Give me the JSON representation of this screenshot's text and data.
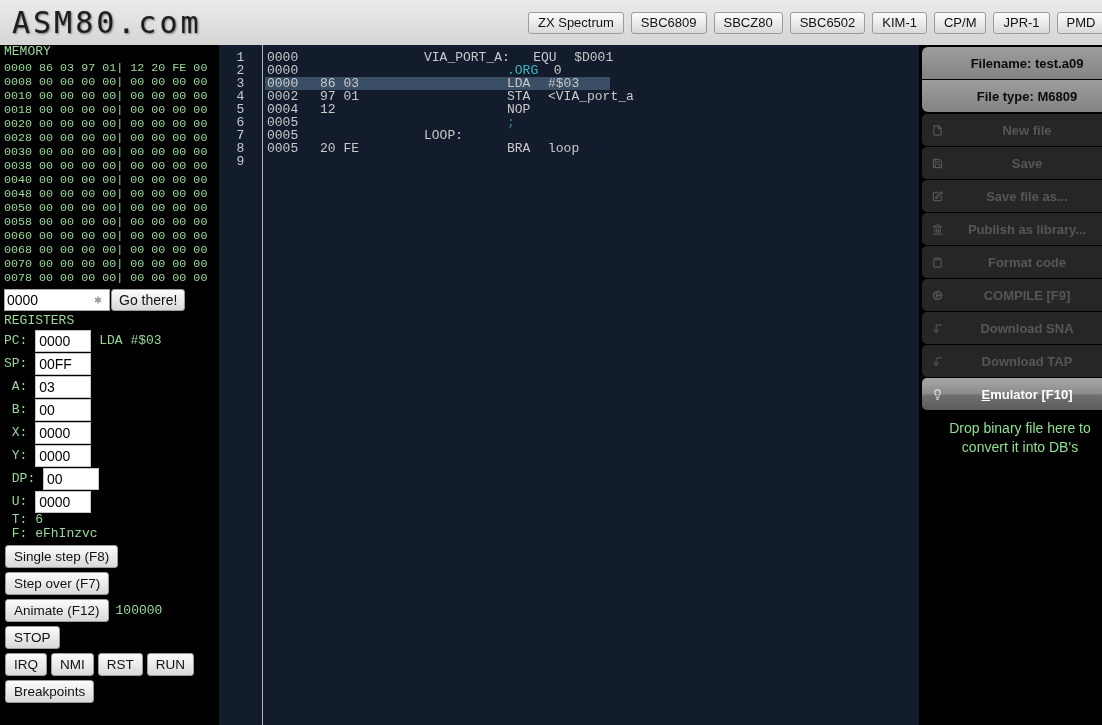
{
  "header": {
    "logo": "ASM80.com",
    "machines": [
      "ZX Spectrum",
      "SBC6809",
      "SBCZ80",
      "SBC6502",
      "KIM-1",
      "CP/M",
      "JPR-1",
      "PMD"
    ]
  },
  "memory": {
    "title": "MEMORY",
    "rows": [
      "0000 86 03 97 01| 12 20 FE 00",
      "0008 00 00 00 00| 00 00 00 00",
      "0010 00 00 00 00| 00 00 00 00",
      "0018 00 00 00 00| 00 00 00 00",
      "0020 00 00 00 00| 00 00 00 00",
      "0028 00 00 00 00| 00 00 00 00",
      "0030 00 00 00 00| 00 00 00 00",
      "0038 00 00 00 00| 00 00 00 00",
      "0040 00 00 00 00| 00 00 00 00",
      "0048 00 00 00 00| 00 00 00 00",
      "0050 00 00 00 00| 00 00 00 00",
      "0058 00 00 00 00| 00 00 00 00",
      "0060 00 00 00 00| 00 00 00 00",
      "0068 00 00 00 00| 00 00 00 00",
      "0070 00 00 00 00| 00 00 00 00",
      "0078 00 00 00 00| 00 00 00 00"
    ],
    "goto": {
      "value": "0000",
      "button": "Go there!"
    }
  },
  "registers": {
    "title": "REGISTERS",
    "fields": [
      {
        "label": "PC:",
        "value": "0000",
        "indented": false,
        "disassembly": "LDA #$03"
      },
      {
        "label": "SP:",
        "value": "00FF",
        "indented": false
      },
      {
        "label": "A:",
        "value": "03",
        "indented": true
      },
      {
        "label": "B:",
        "value": "00",
        "indented": true
      },
      {
        "label": "X:",
        "value": "0000",
        "indented": true
      },
      {
        "label": "Y:",
        "value": "0000",
        "indented": true
      },
      {
        "label": "DP:",
        "value": "00",
        "indented": true
      },
      {
        "label": "U:",
        "value": "0000",
        "indented": true
      }
    ],
    "readouts": [
      {
        "label": "T:",
        "value": "6"
      },
      {
        "label": "F:",
        "value": "eFhInzvc"
      }
    ]
  },
  "controls": [
    {
      "buttons": [
        "Single step (F8)"
      ]
    },
    {
      "buttons": [
        "Step over (F7)"
      ]
    },
    {
      "buttons": [
        "Animate (F12)"
      ],
      "note": "100000"
    },
    {
      "buttons": [
        "STOP"
      ]
    },
    {
      "buttons": [
        "IRQ",
        "NMI",
        "RST",
        "RUN"
      ]
    },
    {
      "buttons": [
        "Breakpoints"
      ]
    }
  ],
  "code": {
    "lines": [
      {
        "number": "1",
        "address": "0000",
        "label": "VIA_PORT_A:",
        "opcode": "EQU",
        "operand": "$D001",
        "kind": "equate",
        "current": false
      },
      {
        "number": "2",
        "address": "0000",
        "opcode": ".ORG",
        "operand": "0",
        "kind": "directive",
        "current": false
      },
      {
        "number": "3",
        "address": "0000",
        "bytes": "86 03",
        "opcode": "LDA",
        "operand": "#$03",
        "kind": "instruction",
        "current": true
      },
      {
        "number": "4",
        "address": "0002",
        "bytes": "97 01",
        "opcode": "STA",
        "operand": "<VIA_port_a",
        "kind": "instruction",
        "current": false
      },
      {
        "number": "5",
        "address": "0004",
        "bytes": "12",
        "opcode": "NOP",
        "kind": "instruction",
        "current": false
      },
      {
        "number": "6",
        "address": "0005",
        "comment": ";",
        "kind": "comment",
        "current": false
      },
      {
        "number": "7",
        "address": "0005",
        "label": "LOOP:",
        "kind": "label",
        "current": false
      },
      {
        "number": "8",
        "address": "0005",
        "bytes": "20 FE",
        "opcode": "BRA",
        "operand": "loop",
        "kind": "instruction",
        "current": false
      },
      {
        "number": "9",
        "kind": "blank",
        "current": false
      }
    ]
  },
  "side_menu": {
    "items": [
      {
        "kind": "info",
        "label": "Filename: test.a09"
      },
      {
        "kind": "info",
        "label": "File type: M6809"
      },
      {
        "kind": "action",
        "label": "New file",
        "disabled": true,
        "selected": false,
        "access_key": false
      },
      {
        "kind": "action",
        "label": "Save",
        "disabled": true,
        "selected": false,
        "access_key": false
      },
      {
        "kind": "action",
        "label": "Save file as...",
        "disabled": true,
        "selected": false,
        "access_key": false
      },
      {
        "kind": "action",
        "label": "Publish as library...",
        "disabled": true,
        "selected": false,
        "access_key": false
      },
      {
        "kind": "action",
        "label": "Format code",
        "disabled": true,
        "selected": false,
        "access_key": false
      },
      {
        "kind": "action",
        "label": "COMPILE [F9]",
        "disabled": true,
        "selected": false,
        "access_key": false
      },
      {
        "kind": "action",
        "label": "Download SNA",
        "disabled": true,
        "selected": false,
        "access_key": false
      },
      {
        "kind": "action",
        "label": "Download TAP",
        "disabled": true,
        "selected": false,
        "access_key": false
      },
      {
        "kind": "action",
        "label": "Emulator [F10]",
        "disabled": false,
        "selected": true,
        "access_key": true
      }
    ],
    "drop_hint": "Drop binary file here to convert it into DB's"
  }
}
